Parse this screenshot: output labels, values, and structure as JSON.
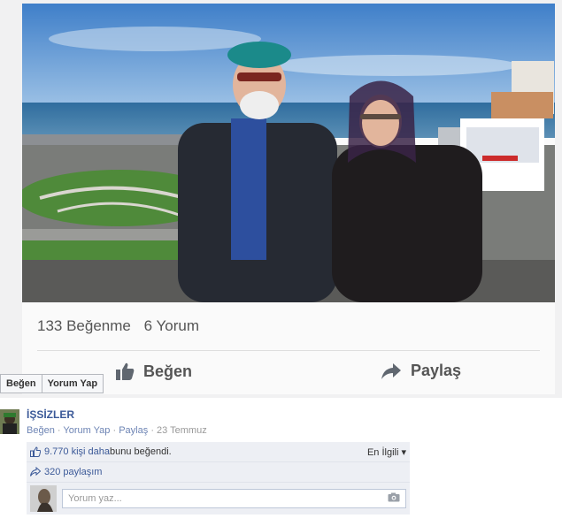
{
  "post": {
    "likes_count": "133 Beğenme",
    "comments_count": "6 Yorum",
    "like_label": "Beğen",
    "share_label": "Paylaş"
  },
  "mini_actions": {
    "like_label": "Beğen",
    "comment_label": "Yorum Yap"
  },
  "comment": {
    "page_name": "İŞSİZLER",
    "actions": [
      "Beğen",
      "Yorum Yap",
      "Paylaş"
    ],
    "date": "23 Temmuz",
    "likes_prefix": "9.770 kişi daha ",
    "likes_suffix": "bunu beğendi.",
    "sort_label": "En İlgili",
    "shares": "320 paylaşım",
    "input_placeholder": "Yorum yaz..."
  },
  "colors": {
    "link": "#3b5998",
    "meta": "#6d84b4",
    "ufi_bg": "#edeff4"
  },
  "icons": [
    "thumbs-up-icon",
    "share-arrow-icon",
    "camera-icon",
    "dropdown-caret-icon"
  ]
}
